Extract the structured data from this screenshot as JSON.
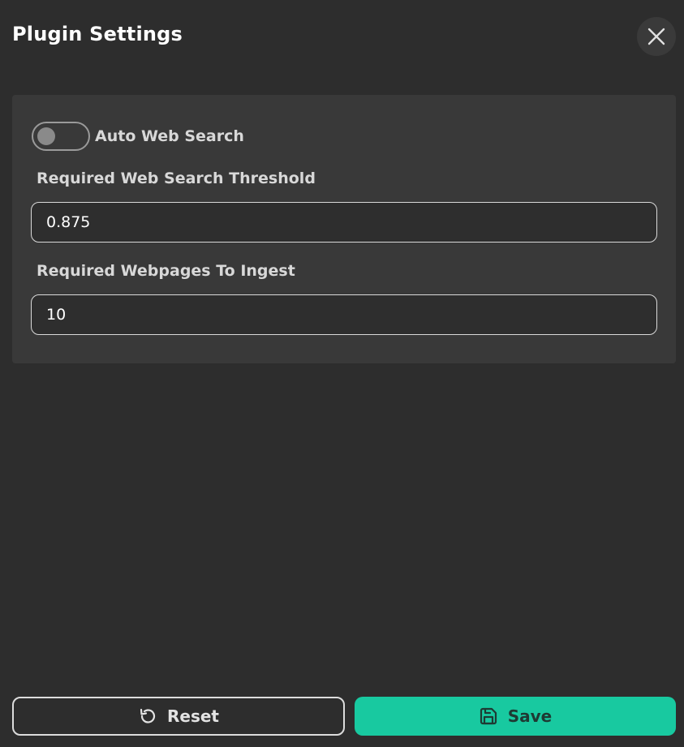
{
  "dialog": {
    "title": "Plugin Settings"
  },
  "settings": {
    "auto_web_search": {
      "label": "Auto Web Search",
      "enabled": false
    },
    "threshold": {
      "label": "Required Web Search Threshold",
      "value": "0.875"
    },
    "webpages": {
      "label": "Required Webpages To Ingest",
      "value": "10"
    }
  },
  "footer": {
    "reset_label": "Reset",
    "save_label": "Save"
  },
  "colors": {
    "background": "#2d2d2d",
    "panel": "#393939",
    "accent": "#18c9a0"
  },
  "icons": {
    "close": "close-icon",
    "reset": "undo-icon",
    "save": "save-icon"
  }
}
